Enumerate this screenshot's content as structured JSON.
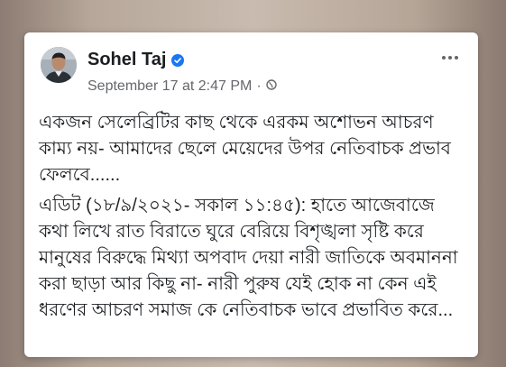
{
  "post": {
    "author": "Sohel Taj",
    "timestamp": "September 17 at 2:47 PM",
    "separator": "·",
    "paragraphs": [
      "একজন সেলেব্রিটির কাছ থেকে এরকম অশোভন আচরণ কাম্য নয়- আমাদের ছেলে মেয়েদের উপর নেতিবাচক প্রভাব ফেলবে......",
      "এডিট (১৮/৯/২০২১- সকাল ১১:৪৫): হাতে আজেবাজে কথা লিখে রাত বিরাতে ঘুরে বেরিয়ে বিশৃঙ্খলা সৃষ্টি করে মানুষের বিরুদ্ধে মিথ্যা অপবাদ দেয়া নারী জাতিকে অবমাননা করা ছাড়া আর কিছু না- নারী পুরুষ যেই হোক না কেন এই ধরণের আচরণ সমাজ কে নেতিবাচক ভাবে প্রভাবিত করে..."
    ]
  },
  "icons": {
    "verified": "verified-badge-icon",
    "privacy": "globe-icon",
    "more": "more-options-icon"
  },
  "colors": {
    "verified": "#1877f2",
    "meta": "#65676b",
    "text": "#1c1e21"
  }
}
